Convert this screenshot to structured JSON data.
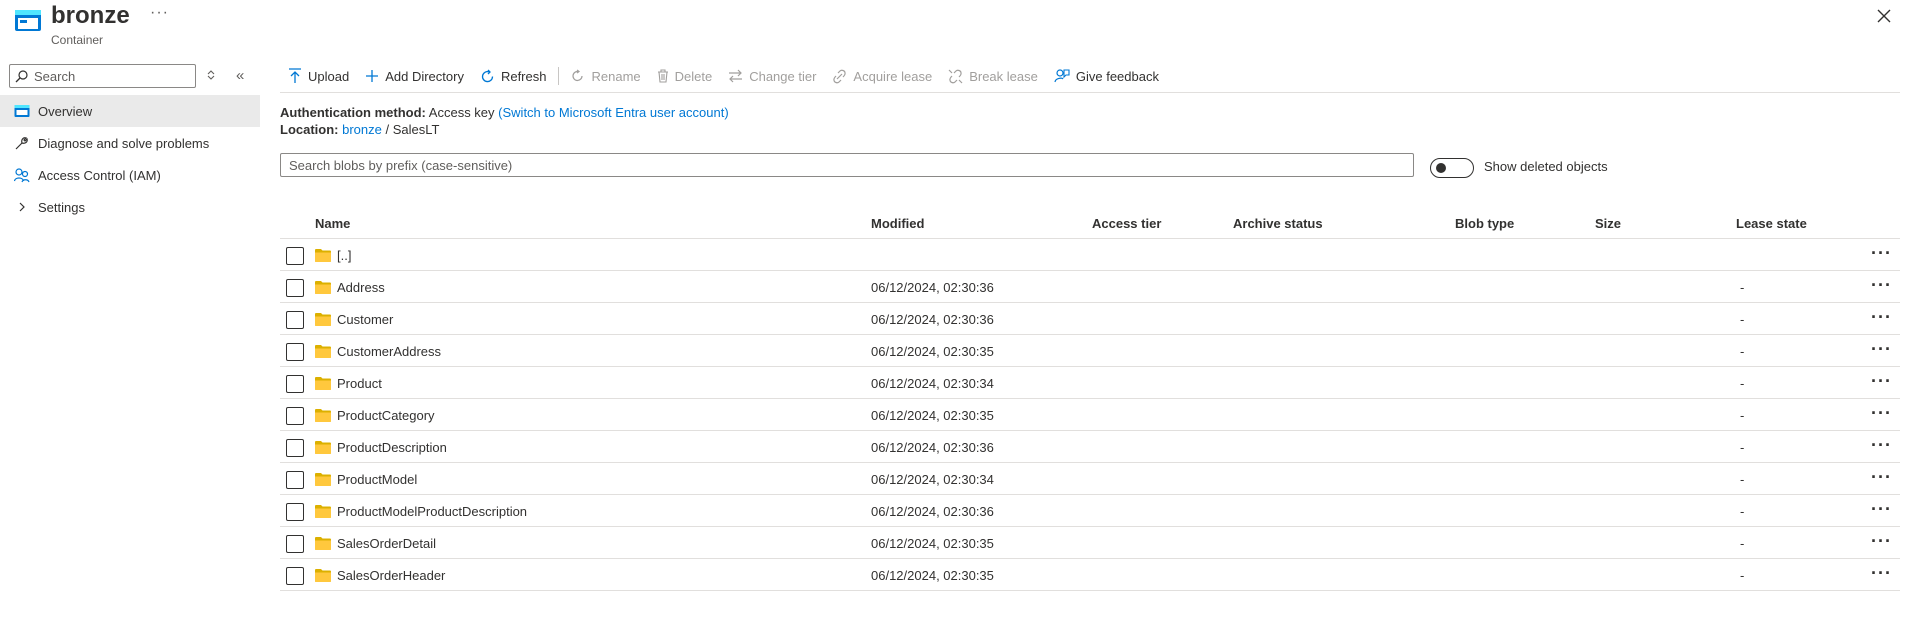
{
  "header": {
    "title": "bronze",
    "subtitle": "Container",
    "more": "···"
  },
  "sidebar": {
    "search_placeholder": "Search",
    "collapse": "«",
    "items": [
      {
        "label": "Overview"
      },
      {
        "label": "Diagnose and solve problems"
      },
      {
        "label": "Access Control (IAM)"
      },
      {
        "label": "Settings"
      }
    ]
  },
  "toolbar": {
    "upload": "Upload",
    "add_directory": "Add Directory",
    "refresh": "Refresh",
    "rename": "Rename",
    "delete": "Delete",
    "change_tier": "Change tier",
    "acquire_lease": "Acquire lease",
    "break_lease": "Break lease",
    "give_feedback": "Give feedback"
  },
  "info": {
    "auth_label": "Authentication method:",
    "auth_value": "Access key",
    "auth_link": "(Switch to Microsoft Entra user account)",
    "location_label": "Location:",
    "location_link": "bronze",
    "location_sep": "/",
    "location_path": "SalesLT"
  },
  "search": {
    "placeholder": "Search blobs by prefix (case-sensitive)"
  },
  "toggle": {
    "label": "Show deleted objects",
    "on": false
  },
  "table": {
    "headers": [
      "Name",
      "Modified",
      "Access tier",
      "Archive status",
      "Blob type",
      "Size",
      "Lease state"
    ],
    "rows": [
      {
        "name": "[..]",
        "modified": "",
        "lease": ""
      },
      {
        "name": "Address",
        "modified": "06/12/2024, 02:30:36",
        "lease": "-"
      },
      {
        "name": "Customer",
        "modified": "06/12/2024, 02:30:36",
        "lease": "-"
      },
      {
        "name": "CustomerAddress",
        "modified": "06/12/2024, 02:30:35",
        "lease": "-"
      },
      {
        "name": "Product",
        "modified": "06/12/2024, 02:30:34",
        "lease": "-"
      },
      {
        "name": "ProductCategory",
        "modified": "06/12/2024, 02:30:35",
        "lease": "-"
      },
      {
        "name": "ProductDescription",
        "modified": "06/12/2024, 02:30:36",
        "lease": "-"
      },
      {
        "name": "ProductModel",
        "modified": "06/12/2024, 02:30:34",
        "lease": "-"
      },
      {
        "name": "ProductModelProductDescription",
        "modified": "06/12/2024, 02:30:36",
        "lease": "-"
      },
      {
        "name": "SalesOrderDetail",
        "modified": "06/12/2024, 02:30:35",
        "lease": "-"
      },
      {
        "name": "SalesOrderHeader",
        "modified": "06/12/2024, 02:30:35",
        "lease": "-"
      }
    ],
    "row_more": "···"
  },
  "colors": {
    "accent": "#0078d4",
    "folder": "#ffc83d",
    "disabled": "#a19f9d"
  },
  "icons": {
    "container": "container-icon",
    "close": "close-icon",
    "search": "search-icon",
    "folder": "folder-icon"
  }
}
